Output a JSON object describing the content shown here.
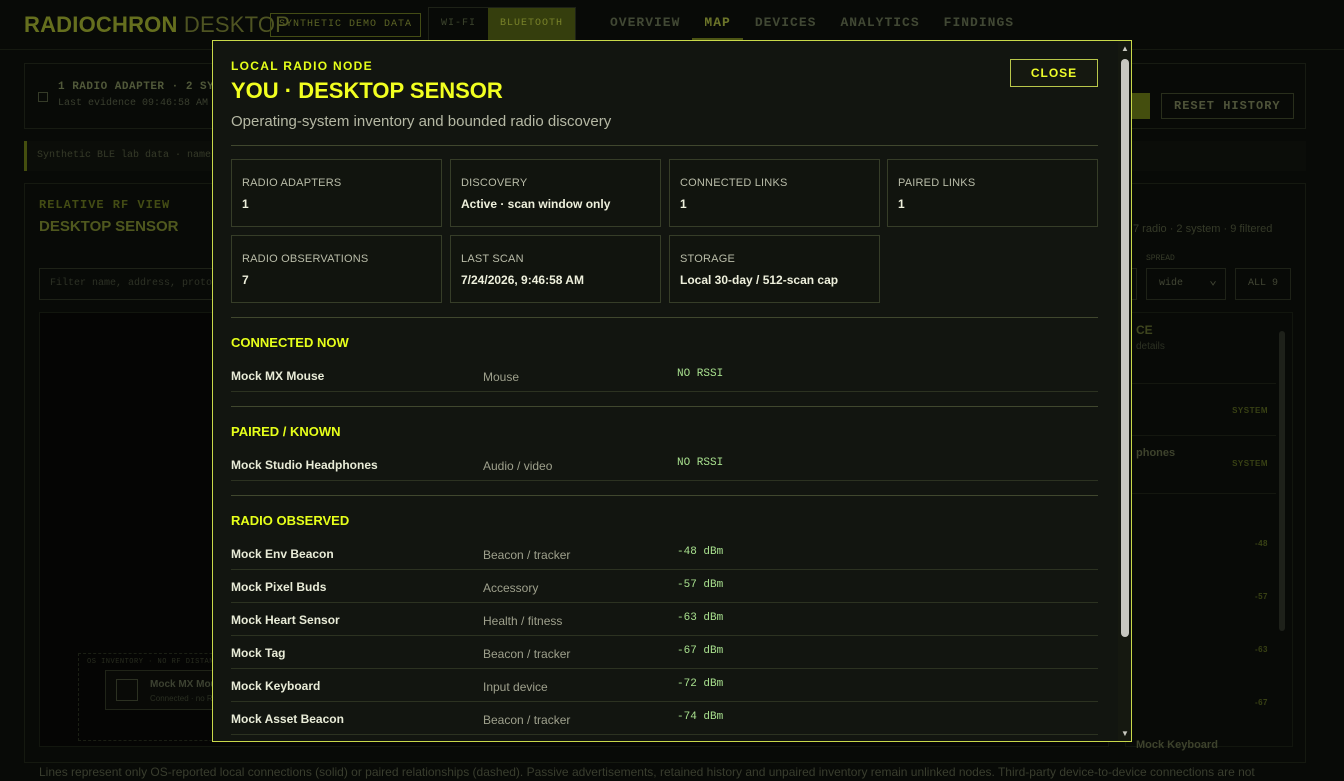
{
  "app": {
    "brand_bold": "RADIOCHRON",
    "brand_light": " DESKTOP",
    "demo_badge": "SYNTHETIC DEMO DATA",
    "radio_tabs": [
      "WI-FI",
      "BLUETOOTH"
    ],
    "nav": [
      "OVERVIEW",
      "MAP",
      "DEVICES",
      "ANALYTICS",
      "FINDINGS"
    ],
    "active_nav": "MAP",
    "status_line1": "1 RADIO ADAPTER · 2 SYS",
    "status_line2": "Last evidence 09:46:58 AM",
    "reset_history": "RESET HISTORY",
    "notice": "Synthetic BLE lab data · name",
    "rf_kicker": "RELATIVE RF VIEW",
    "rf_title": "DESKTOP SENSOR",
    "rf_filter_placeholder": "Filter name, address, protoc",
    "rf_summary": "7 radio · 2 system · 9 filtered",
    "rf_spread_label": "SPREAD",
    "rf_spread_value": "wide",
    "rf_all": "ALL 9",
    "os_inventory_label": "OS INVENTORY · NO RF DISTANCE",
    "os_card_name": "Mock MX Mou",
    "os_card_status": "Connected · no RS",
    "side_head": "CE",
    "side_sub": "details",
    "side_tag": "SYSTEM",
    "side_headphones": "phones",
    "side_keyboard": "Mock Keyboard",
    "side_rssi": [
      "-48",
      "-57",
      "-63",
      "-67"
    ],
    "legend": "Lines represent only OS-reported local connections (solid) or paired relationships (dashed). Passive advertisements, retained history and unpaired inventory remain unlinked nodes. Third-party device-to-device connections are not"
  },
  "modal": {
    "kicker": "LOCAL RADIO NODE",
    "title": "YOU · DESKTOP SENSOR",
    "subtitle": "Operating-system inventory and bounded radio discovery",
    "close_label": "CLOSE",
    "stats": [
      {
        "label": "RADIO ADAPTERS",
        "value": "1"
      },
      {
        "label": "DISCOVERY",
        "value": "Active · scan window only"
      },
      {
        "label": "CONNECTED LINKS",
        "value": "1"
      },
      {
        "label": "PAIRED LINKS",
        "value": "1"
      },
      {
        "label": "RADIO OBSERVATIONS",
        "value": "7"
      },
      {
        "label": "LAST SCAN",
        "value": "7/24/2026, 9:46:58 AM"
      },
      {
        "label": "STORAGE",
        "value": "Local 30-day / 512-scan cap"
      }
    ],
    "sections": {
      "connected": {
        "title": "CONNECTED NOW",
        "rows": [
          {
            "name": "Mock MX Mouse",
            "kind": "Mouse",
            "signal": "NO RSSI"
          }
        ]
      },
      "paired": {
        "title": "PAIRED / KNOWN",
        "rows": [
          {
            "name": "Mock Studio Headphones",
            "kind": "Audio / video",
            "signal": "NO RSSI"
          }
        ]
      },
      "observed": {
        "title": "RADIO OBSERVED",
        "rows": [
          {
            "name": "Mock Env Beacon",
            "kind": "Beacon / tracker",
            "signal": "-48 dBm"
          },
          {
            "name": "Mock Pixel Buds",
            "kind": "Accessory",
            "signal": "-57 dBm"
          },
          {
            "name": "Mock Heart Sensor",
            "kind": "Health / fitness",
            "signal": "-63 dBm"
          },
          {
            "name": "Mock Tag",
            "kind": "Beacon / tracker",
            "signal": "-67 dBm"
          },
          {
            "name": "Mock Keyboard",
            "kind": "Input device",
            "signal": "-72 dBm"
          },
          {
            "name": "Mock Asset Beacon",
            "kind": "Beacon / tracker",
            "signal": "-74 dBm"
          }
        ]
      }
    }
  }
}
